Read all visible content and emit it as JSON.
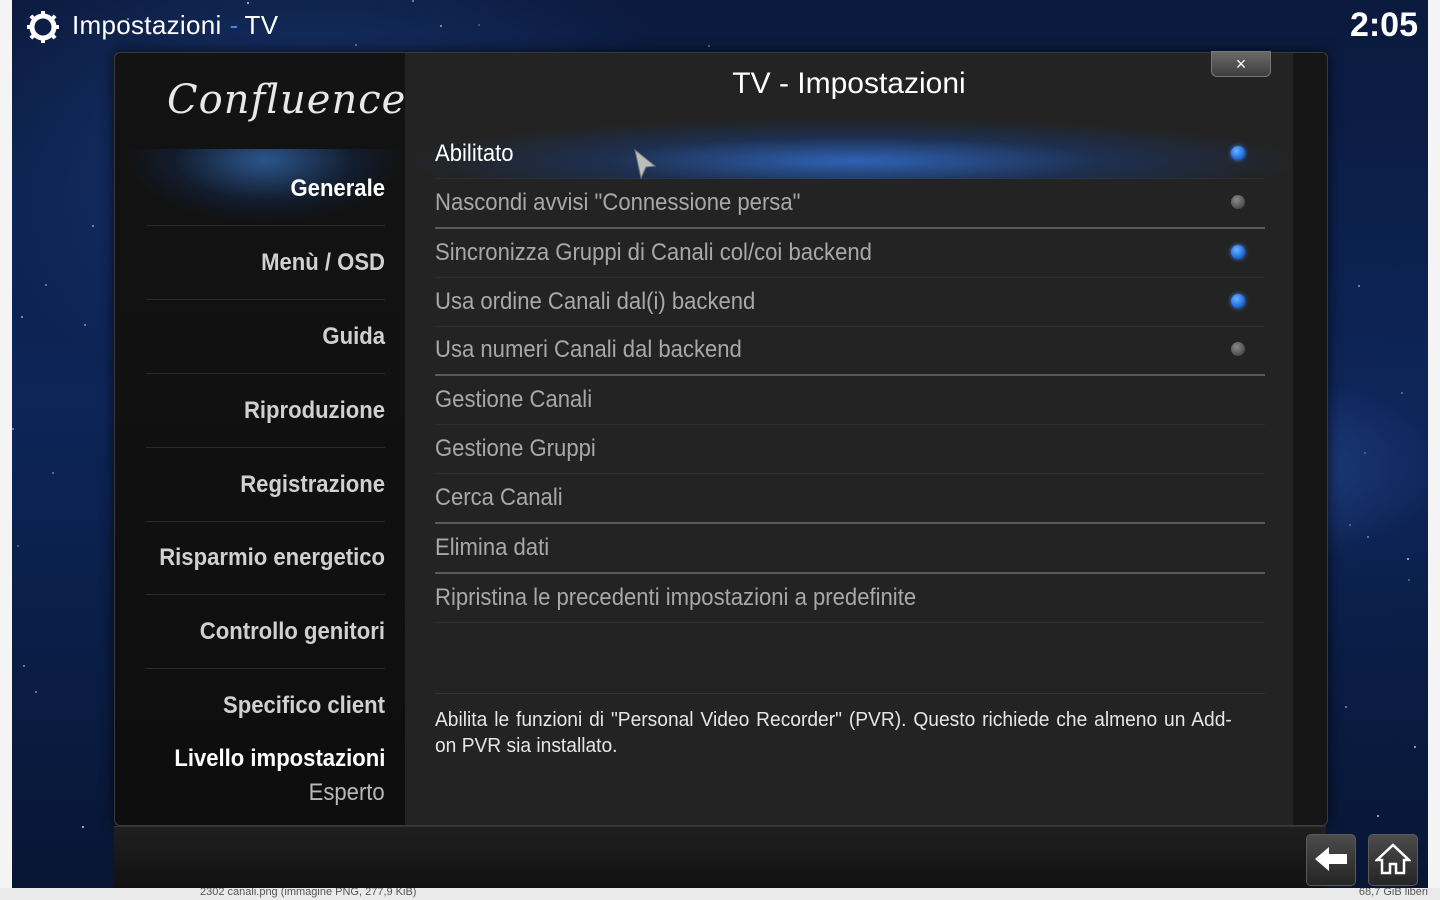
{
  "host": {
    "status_left": "2302 canali.png (immagine PNG, 277,9 KiB)",
    "status_right": "68,7 GiB liberi"
  },
  "topbar": {
    "section": "Impostazioni",
    "subsection": "TV",
    "separator": "-",
    "clock": "2:05"
  },
  "dialog": {
    "title": "TV - Impostazioni",
    "close_label": "×"
  },
  "sidebar": {
    "logo": "Confluence",
    "items": [
      {
        "label": "Generale"
      },
      {
        "label": "Menù / OSD"
      },
      {
        "label": "Guida"
      },
      {
        "label": "Riproduzione"
      },
      {
        "label": "Registrazione"
      },
      {
        "label": "Risparmio energetico"
      },
      {
        "label": "Controllo genitori"
      },
      {
        "label": "Specifico client"
      }
    ],
    "level_label": "Livello impostazioni",
    "level_value": "Esperto"
  },
  "settings": [
    {
      "label": "Abilitato",
      "toggle": true
    },
    {
      "label": "Nascondi avvisi \"Connessione persa\"",
      "toggle": false
    },
    {
      "label": "Sincronizza Gruppi di Canali col/coi backend",
      "toggle": true
    },
    {
      "label": "Usa ordine Canali dal(i) backend",
      "toggle": true
    },
    {
      "label": "Usa numeri Canali dal backend",
      "toggle": false
    },
    {
      "label": "Gestione Canali"
    },
    {
      "label": "Gestione Gruppi"
    },
    {
      "label": "Cerca Canali"
    },
    {
      "label": "Elimina dati"
    },
    {
      "label": "Ripristina le precedenti impostazioni a predefinite"
    }
  ],
  "description": "Abilita le funzioni di \"Personal Video Recorder\" (PVR). Questo richiede che almeno un Add-on PVR sia installato.",
  "colors": {
    "accent": "#3d8be4",
    "toggle_on": "#1f6fe0",
    "toggle_off": "#5a5a5a"
  }
}
